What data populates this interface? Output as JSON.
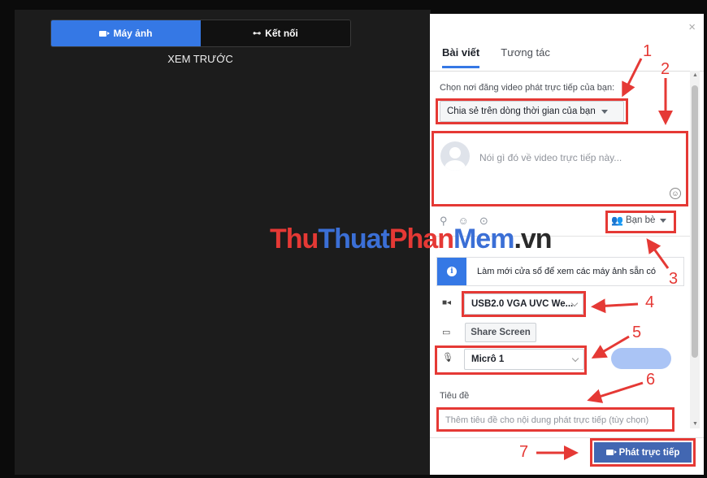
{
  "preview": {
    "tabs": [
      {
        "label": "Máy ảnh",
        "icon": "video-camera-icon",
        "active": true
      },
      {
        "label": "Kết nối",
        "icon": "connect-icon",
        "active": false
      }
    ],
    "label": "XEM TRƯỚC"
  },
  "panel": {
    "close": "×",
    "tabs": [
      {
        "label": "Bài viết",
        "active": true
      },
      {
        "label": "Tương tác",
        "active": false
      }
    ],
    "destination_label": "Chọn nơi đăng video phát trực tiếp của bạn:",
    "destination_value": "Chia sẻ trên dòng thời gian của bạn",
    "compose_placeholder": "Nói gì đó về video trực tiếp này...",
    "audience": "Bạn bè",
    "notice": "Làm mới cửa sổ để xem các máy ảnh sẵn có",
    "camera_value": "USB2.0 VGA UVC We...",
    "share_screen": "Share Screen",
    "mic_value": "Micrô 1",
    "title_label": "Tiêu đề",
    "title_placeholder": "Thêm tiêu đề cho nội dung phát trực tiếp (tùy chọn)",
    "go_live": "Phát trực tiếp"
  },
  "annotations": {
    "numbers": [
      "1",
      "2",
      "3",
      "4",
      "5",
      "6",
      "7"
    ],
    "color": "#e53935"
  },
  "watermark": {
    "part1": "Thu",
    "part2": "Thuat",
    "part3": "Phan",
    "part4": "Mem",
    "part5": ".vn"
  }
}
